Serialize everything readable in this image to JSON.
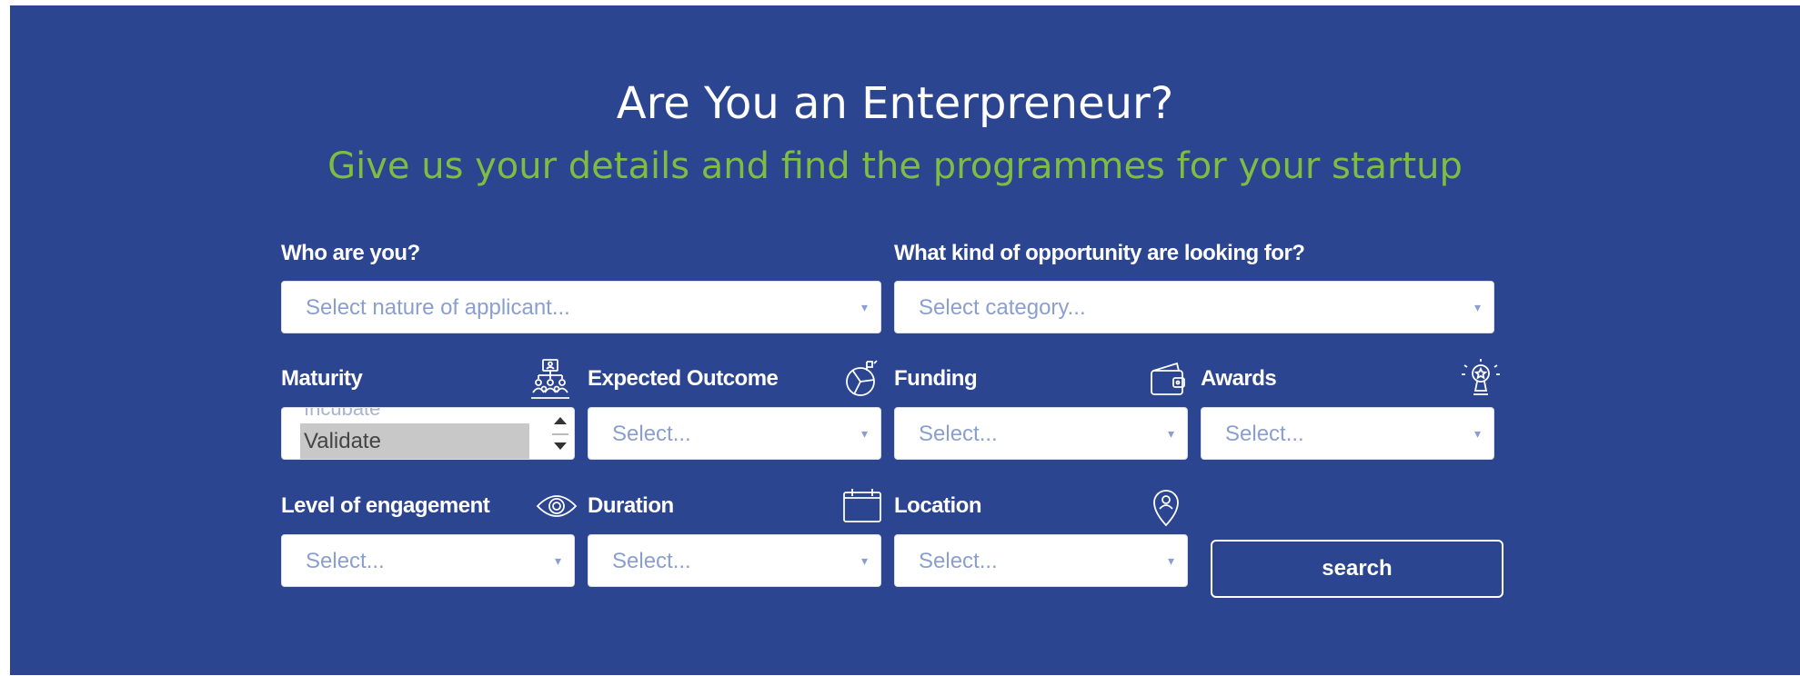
{
  "heading": "Are You an Enterpreneur?",
  "subheading": "Give us your details and find the programmes for your startup",
  "colors": {
    "background": "#2c4591",
    "accent_green": "#7fbd42",
    "placeholder": "#8b9fcf"
  },
  "fields": {
    "who": {
      "label": "Who are you?",
      "placeholder": "Select nature of applicant..."
    },
    "opportunity": {
      "label": "What kind of opportunity are looking for?",
      "placeholder": "Select category..."
    },
    "maturity": {
      "label": "Maturity",
      "icon": "team-structure-icon",
      "options_visible": [
        "Incubate",
        "Validate"
      ],
      "selected": "Validate"
    },
    "outcome": {
      "label": "Expected Outcome",
      "icon": "chart-outcome-icon",
      "placeholder": "Select..."
    },
    "funding": {
      "label": "Funding",
      "icon": "wallet-icon",
      "placeholder": "Select..."
    },
    "awards": {
      "label": "Awards",
      "icon": "trophy-icon",
      "placeholder": "Select..."
    },
    "engagement": {
      "label": "Level of engagement",
      "icon": "eye-icon",
      "placeholder": "Select..."
    },
    "duration": {
      "label": "Duration",
      "icon": "calendar-icon",
      "placeholder": "Select..."
    },
    "location": {
      "label": "Location",
      "icon": "location-pin-icon",
      "placeholder": "Select..."
    }
  },
  "search_button": "search",
  "caret_glyph": "▾"
}
